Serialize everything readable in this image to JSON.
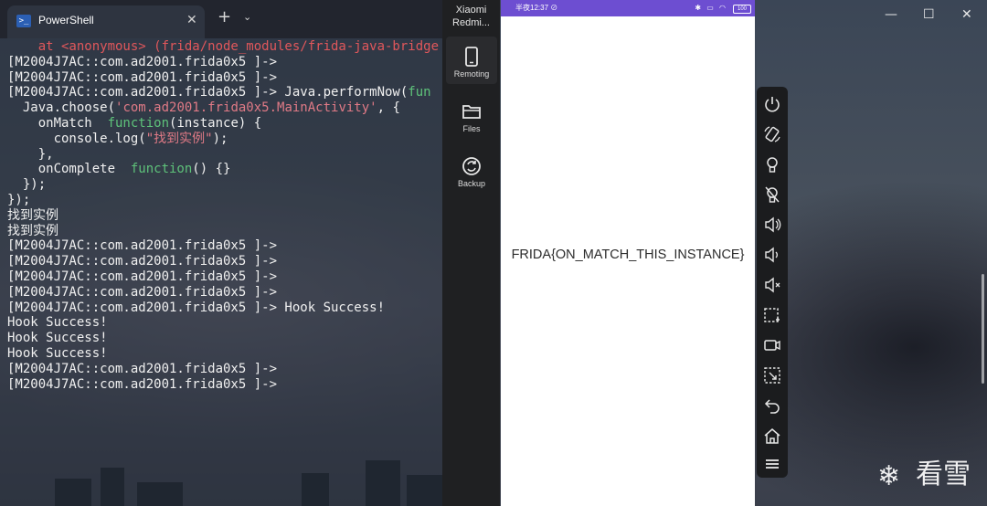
{
  "terminal": {
    "tab_title": "PowerShell",
    "tab_close": "✕",
    "new_tab": "+",
    "dropdown": "⌄",
    "lines": [
      {
        "segments": [
          {
            "text": "    at <anonymous> (frida/node_modules/frida-java-bridge",
            "color": "red"
          }
        ]
      },
      {
        "segments": [
          {
            "text": "[M2004J7AC::com.ad2001.frida0x5 ]->",
            "color": "white"
          }
        ]
      },
      {
        "segments": [
          {
            "text": "[M2004J7AC::com.ad2001.frida0x5 ]->",
            "color": "white"
          }
        ]
      },
      {
        "segments": [
          {
            "text": "[M2004J7AC::com.ad2001.frida0x5 ]-> Java.performNow(",
            "color": "white"
          },
          {
            "text": "fun",
            "color": "green"
          }
        ]
      },
      {
        "segments": [
          {
            "text": "  Java.choose(",
            "color": "white"
          },
          {
            "text": "'com.ad2001.frida0x5.MainActivity'",
            "color": "pink"
          },
          {
            "text": ", {",
            "color": "white"
          }
        ]
      },
      {
        "segments": [
          {
            "text": "    onMatch  ",
            "color": "white"
          },
          {
            "text": "function",
            "color": "green"
          },
          {
            "text": "(instance) {",
            "color": "white"
          }
        ]
      },
      {
        "segments": [
          {
            "text": "      console.log(",
            "color": "white"
          },
          {
            "text": "\"找到实例\"",
            "color": "pink"
          },
          {
            "text": ");",
            "color": "white"
          }
        ]
      },
      {
        "segments": [
          {
            "text": "    },",
            "color": "white"
          }
        ]
      },
      {
        "segments": [
          {
            "text": "    onComplete  ",
            "color": "white"
          },
          {
            "text": "function",
            "color": "green"
          },
          {
            "text": "() {}",
            "color": "white"
          }
        ]
      },
      {
        "segments": [
          {
            "text": "  });",
            "color": "white"
          }
        ]
      },
      {
        "segments": [
          {
            "text": "});",
            "color": "white"
          }
        ]
      },
      {
        "segments": [
          {
            "text": "找到实例",
            "color": "white"
          }
        ]
      },
      {
        "segments": [
          {
            "text": "找到实例",
            "color": "white"
          }
        ]
      },
      {
        "segments": [
          {
            "text": "[M2004J7AC::com.ad2001.frida0x5 ]->",
            "color": "white"
          }
        ]
      },
      {
        "segments": [
          {
            "text": "[M2004J7AC::com.ad2001.frida0x5 ]->",
            "color": "white"
          }
        ]
      },
      {
        "segments": [
          {
            "text": "[M2004J7AC::com.ad2001.frida0x5 ]->",
            "color": "white"
          }
        ]
      },
      {
        "segments": [
          {
            "text": "[M2004J7AC::com.ad2001.frida0x5 ]->",
            "color": "white"
          }
        ]
      },
      {
        "segments": [
          {
            "text": "[M2004J7AC::com.ad2001.frida0x5 ]-> Hook Success!",
            "color": "white"
          }
        ]
      },
      {
        "segments": [
          {
            "text": "Hook Success!",
            "color": "white"
          }
        ]
      },
      {
        "segments": [
          {
            "text": "Hook Success!",
            "color": "white"
          }
        ]
      },
      {
        "segments": [
          {
            "text": "Hook Success!",
            "color": "white"
          }
        ]
      },
      {
        "segments": [
          {
            "text": "[M2004J7AC::com.ad2001.frida0x5 ]->",
            "color": "white"
          }
        ]
      },
      {
        "segments": [
          {
            "text": "[M2004J7AC::com.ad2001.frida0x5 ]->",
            "color": "white"
          }
        ]
      }
    ]
  },
  "sidebar": {
    "device_name_line1": "Xiaomi",
    "device_name_line2": "Redmi...",
    "items": [
      {
        "label": "Remoting",
        "icon": "phone-icon"
      },
      {
        "label": "Files",
        "icon": "folder-icon"
      },
      {
        "label": "Backup",
        "icon": "sync-icon"
      }
    ],
    "accent": "#4aa3ff"
  },
  "phone": {
    "status_time": "半夜12:37",
    "status_extra": "⊘",
    "status_icons": "✱ ▭ ◠",
    "battery": "100",
    "status_color": "#6d4ed1",
    "flag_text": "FRIDA{ON_MATCH_THIS_INSTANCE}"
  },
  "window": {
    "minimize": "—",
    "maximize": "☐",
    "close": "✕"
  },
  "toolbar": {
    "buttons": [
      "power-icon",
      "rotate-icon",
      "light-on-icon",
      "light-off-icon",
      "volume-up-icon",
      "volume-down-icon",
      "volume-mute-icon",
      "screenshot-icon",
      "record-icon",
      "region-capture-icon",
      "back-icon",
      "home-icon",
      "menu-icon"
    ]
  },
  "watermark": {
    "snow": "❄",
    "text": "看雪"
  }
}
